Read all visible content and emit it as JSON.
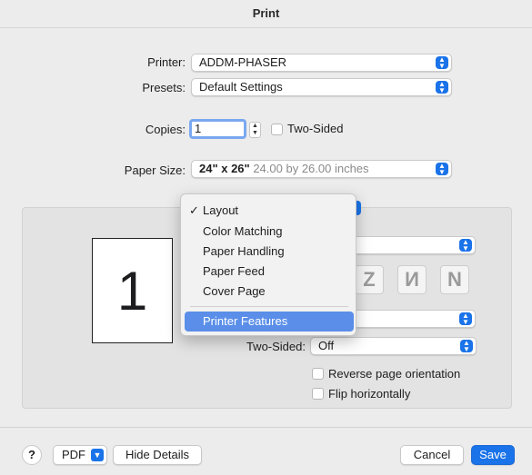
{
  "title": "Print",
  "printer": {
    "label": "Printer:",
    "value": "ADDM-PHASER"
  },
  "presets": {
    "label": "Presets:",
    "value": "Default Settings"
  },
  "copies": {
    "label": "Copies:",
    "value": "1",
    "two_sided_label": "Two-Sided"
  },
  "paper_size": {
    "label": "Paper Size:",
    "value_bold": "24\" x 26\"",
    "value_detail": "24.00 by 26.00 inches"
  },
  "preview": {
    "page_number": "1"
  },
  "menu": {
    "items": [
      {
        "label": "Layout",
        "checked": true
      },
      {
        "label": "Color Matching"
      },
      {
        "label": "Paper Handling"
      },
      {
        "label": "Paper Feed"
      },
      {
        "label": "Cover Page"
      },
      {
        "label": "Printer Features",
        "highlighted": true
      }
    ]
  },
  "layout": {
    "two_sided_label": "Two-Sided:",
    "two_sided_value": "Off",
    "reverse_label": "Reverse page orientation",
    "flip_label": "Flip horizontally"
  },
  "footer": {
    "help": "?",
    "pdf": "PDF",
    "hide_details": "Hide Details",
    "cancel": "Cancel",
    "save": "Save"
  },
  "colors": {
    "accent": "#1a73e8",
    "highlight": "#5a8ee8"
  }
}
